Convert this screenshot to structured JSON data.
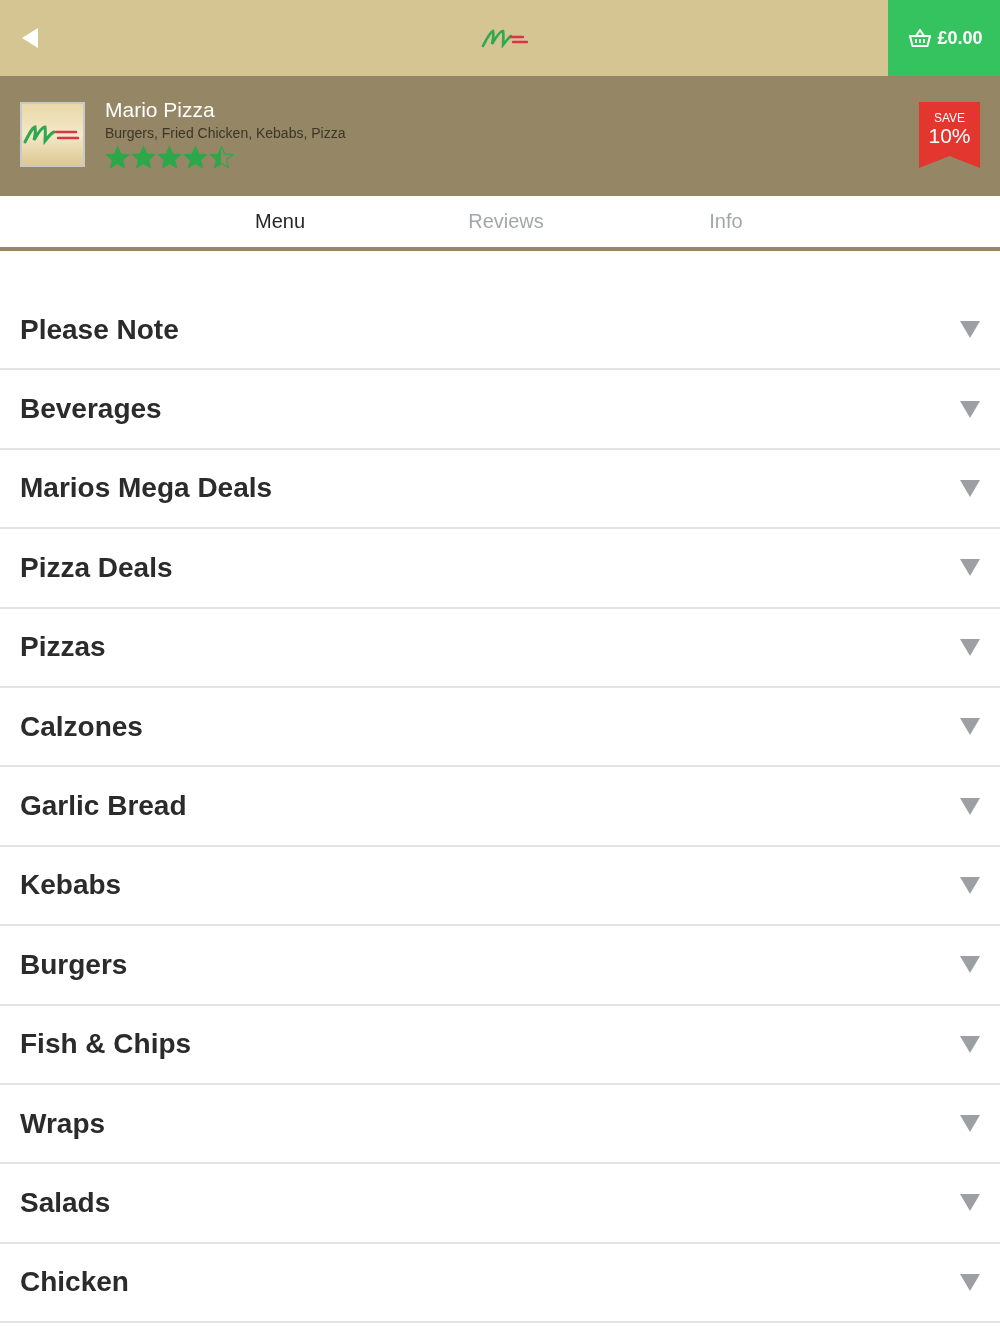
{
  "top_bar": {
    "cart_total": "£0.00"
  },
  "restaurant": {
    "name": "Mario Pizza",
    "cuisines": "Burgers, Fried Chicken, Kebabs, Pizza",
    "stars": 4.5,
    "badge": {
      "label": "SAVE",
      "value": "10%"
    }
  },
  "tabs": [
    {
      "label": "Menu",
      "selected": true
    },
    {
      "label": "Reviews",
      "selected": false
    },
    {
      "label": "Info",
      "selected": false
    }
  ],
  "menu_sections": [
    {
      "title": "Please Note",
      "expanded": false
    },
    {
      "title": "Beverages",
      "expanded": false
    },
    {
      "title": "Marios Mega Deals",
      "expanded": false
    },
    {
      "title": "Pizza Deals",
      "expanded": false
    },
    {
      "title": "Pizzas",
      "expanded": false
    },
    {
      "title": "Calzones",
      "expanded": false
    },
    {
      "title": "Garlic Bread",
      "expanded": false
    },
    {
      "title": "Kebabs",
      "expanded": false
    },
    {
      "title": "Burgers",
      "expanded": false
    },
    {
      "title": "Fish & Chips",
      "expanded": false
    },
    {
      "title": "Wraps",
      "expanded": false
    },
    {
      "title": "Salads",
      "expanded": false
    },
    {
      "title": "Chicken",
      "expanded": false
    }
  ]
}
